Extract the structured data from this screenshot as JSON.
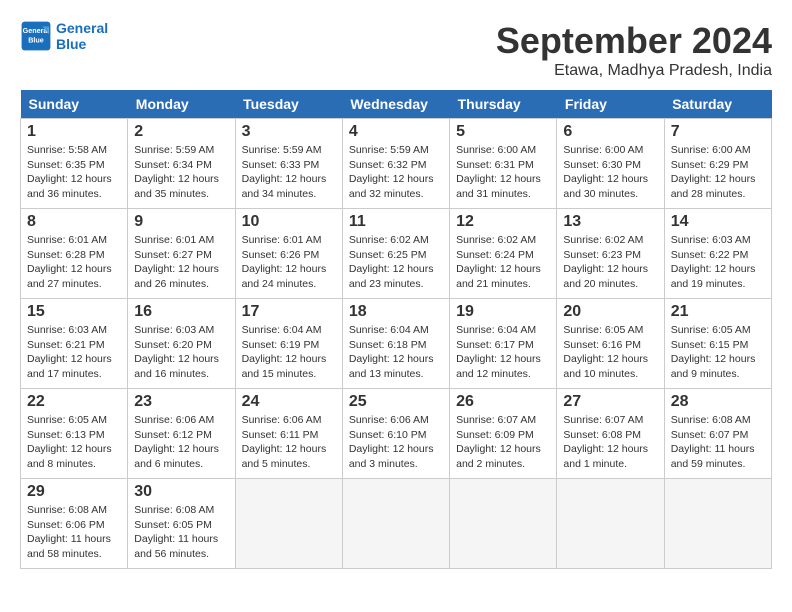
{
  "header": {
    "logo_line1": "General",
    "logo_line2": "Blue",
    "month_title": "September 2024",
    "location": "Etawa, Madhya Pradesh, India"
  },
  "weekdays": [
    "Sunday",
    "Monday",
    "Tuesday",
    "Wednesday",
    "Thursday",
    "Friday",
    "Saturday"
  ],
  "weeks": [
    [
      {
        "day": "1",
        "info": "Sunrise: 5:58 AM\nSunset: 6:35 PM\nDaylight: 12 hours\nand 36 minutes."
      },
      {
        "day": "2",
        "info": "Sunrise: 5:59 AM\nSunset: 6:34 PM\nDaylight: 12 hours\nand 35 minutes."
      },
      {
        "day": "3",
        "info": "Sunrise: 5:59 AM\nSunset: 6:33 PM\nDaylight: 12 hours\nand 34 minutes."
      },
      {
        "day": "4",
        "info": "Sunrise: 5:59 AM\nSunset: 6:32 PM\nDaylight: 12 hours\nand 32 minutes."
      },
      {
        "day": "5",
        "info": "Sunrise: 6:00 AM\nSunset: 6:31 PM\nDaylight: 12 hours\nand 31 minutes."
      },
      {
        "day": "6",
        "info": "Sunrise: 6:00 AM\nSunset: 6:30 PM\nDaylight: 12 hours\nand 30 minutes."
      },
      {
        "day": "7",
        "info": "Sunrise: 6:00 AM\nSunset: 6:29 PM\nDaylight: 12 hours\nand 28 minutes."
      }
    ],
    [
      {
        "day": "8",
        "info": "Sunrise: 6:01 AM\nSunset: 6:28 PM\nDaylight: 12 hours\nand 27 minutes."
      },
      {
        "day": "9",
        "info": "Sunrise: 6:01 AM\nSunset: 6:27 PM\nDaylight: 12 hours\nand 26 minutes."
      },
      {
        "day": "10",
        "info": "Sunrise: 6:01 AM\nSunset: 6:26 PM\nDaylight: 12 hours\nand 24 minutes."
      },
      {
        "day": "11",
        "info": "Sunrise: 6:02 AM\nSunset: 6:25 PM\nDaylight: 12 hours\nand 23 minutes."
      },
      {
        "day": "12",
        "info": "Sunrise: 6:02 AM\nSunset: 6:24 PM\nDaylight: 12 hours\nand 21 minutes."
      },
      {
        "day": "13",
        "info": "Sunrise: 6:02 AM\nSunset: 6:23 PM\nDaylight: 12 hours\nand 20 minutes."
      },
      {
        "day": "14",
        "info": "Sunrise: 6:03 AM\nSunset: 6:22 PM\nDaylight: 12 hours\nand 19 minutes."
      }
    ],
    [
      {
        "day": "15",
        "info": "Sunrise: 6:03 AM\nSunset: 6:21 PM\nDaylight: 12 hours\nand 17 minutes."
      },
      {
        "day": "16",
        "info": "Sunrise: 6:03 AM\nSunset: 6:20 PM\nDaylight: 12 hours\nand 16 minutes."
      },
      {
        "day": "17",
        "info": "Sunrise: 6:04 AM\nSunset: 6:19 PM\nDaylight: 12 hours\nand 15 minutes."
      },
      {
        "day": "18",
        "info": "Sunrise: 6:04 AM\nSunset: 6:18 PM\nDaylight: 12 hours\nand 13 minutes."
      },
      {
        "day": "19",
        "info": "Sunrise: 6:04 AM\nSunset: 6:17 PM\nDaylight: 12 hours\nand 12 minutes."
      },
      {
        "day": "20",
        "info": "Sunrise: 6:05 AM\nSunset: 6:16 PM\nDaylight: 12 hours\nand 10 minutes."
      },
      {
        "day": "21",
        "info": "Sunrise: 6:05 AM\nSunset: 6:15 PM\nDaylight: 12 hours\nand 9 minutes."
      }
    ],
    [
      {
        "day": "22",
        "info": "Sunrise: 6:05 AM\nSunset: 6:13 PM\nDaylight: 12 hours\nand 8 minutes."
      },
      {
        "day": "23",
        "info": "Sunrise: 6:06 AM\nSunset: 6:12 PM\nDaylight: 12 hours\nand 6 minutes."
      },
      {
        "day": "24",
        "info": "Sunrise: 6:06 AM\nSunset: 6:11 PM\nDaylight: 12 hours\nand 5 minutes."
      },
      {
        "day": "25",
        "info": "Sunrise: 6:06 AM\nSunset: 6:10 PM\nDaylight: 12 hours\nand 3 minutes."
      },
      {
        "day": "26",
        "info": "Sunrise: 6:07 AM\nSunset: 6:09 PM\nDaylight: 12 hours\nand 2 minutes."
      },
      {
        "day": "27",
        "info": "Sunrise: 6:07 AM\nSunset: 6:08 PM\nDaylight: 12 hours\nand 1 minute."
      },
      {
        "day": "28",
        "info": "Sunrise: 6:08 AM\nSunset: 6:07 PM\nDaylight: 11 hours\nand 59 minutes."
      }
    ],
    [
      {
        "day": "29",
        "info": "Sunrise: 6:08 AM\nSunset: 6:06 PM\nDaylight: 11 hours\nand 58 minutes."
      },
      {
        "day": "30",
        "info": "Sunrise: 6:08 AM\nSunset: 6:05 PM\nDaylight: 11 hours\nand 56 minutes."
      },
      {
        "day": "",
        "info": ""
      },
      {
        "day": "",
        "info": ""
      },
      {
        "day": "",
        "info": ""
      },
      {
        "day": "",
        "info": ""
      },
      {
        "day": "",
        "info": ""
      }
    ]
  ]
}
